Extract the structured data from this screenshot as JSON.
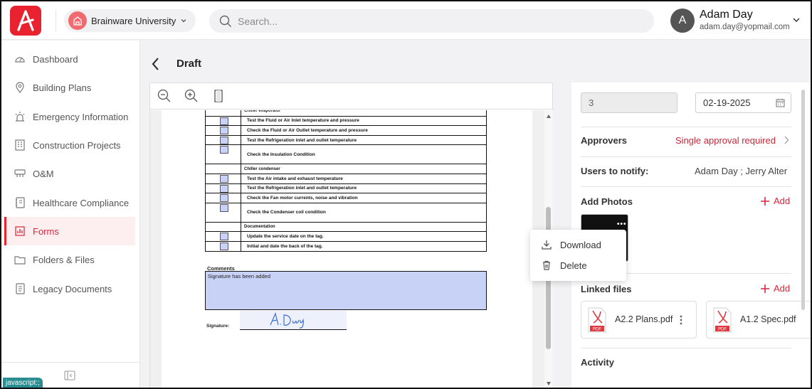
{
  "org": {
    "name": "Brainware University"
  },
  "search": {
    "placeholder": "Search..."
  },
  "user": {
    "initial": "A",
    "name": "Adam Day",
    "email": "adam.day@yopmail.com"
  },
  "sidebar": {
    "items": [
      {
        "label": "Dashboard",
        "icon": "dashboard-icon"
      },
      {
        "label": "Building Plans",
        "icon": "location-pin-icon"
      },
      {
        "label": "Emergency Information",
        "icon": "alarm-light-icon"
      },
      {
        "label": "Construction Projects",
        "icon": "building-icon"
      },
      {
        "label": "O&M",
        "icon": "hvac-icon"
      },
      {
        "label": "Healthcare Compliance",
        "icon": "notebook-icon"
      },
      {
        "label": "Forms",
        "icon": "bar-chart-icon",
        "active": true
      },
      {
        "label": "Folders & Files",
        "icon": "folder-icon"
      },
      {
        "label": "Legacy Documents",
        "icon": "document-icon"
      }
    ],
    "status_tip": "javascript:;"
  },
  "page": {
    "title": "Draft"
  },
  "document": {
    "rows": [
      {
        "type": "section",
        "text": "Chiller evaporator"
      },
      {
        "type": "item",
        "text": "Test the Fluid or Air Inlet temperature and pressure"
      },
      {
        "type": "item",
        "text": "Check the Fluid or Air Outlet temperature and pressure"
      },
      {
        "type": "item",
        "text": "Test the Refrigeration inlet and outlet temperature"
      },
      {
        "type": "item-tall",
        "text": "Check the Insulation Condition"
      },
      {
        "type": "section",
        "text": "Chiller condenser"
      },
      {
        "type": "item",
        "text": "Test the Air intake and exhaust temperature"
      },
      {
        "type": "item",
        "text": "Test the Refrigeration inlet and outlet temperature"
      },
      {
        "type": "item",
        "text": "Check the Fan motor currents, noise and vibration"
      },
      {
        "type": "item-tall",
        "text": "Check the Condenser coil condition"
      },
      {
        "type": "section",
        "text": "Documentation"
      },
      {
        "type": "item",
        "text": "Update the service date on the tag."
      },
      {
        "type": "item",
        "text": "Initial and date the back of the tag."
      }
    ],
    "comments_label": "Comments",
    "comments_text": "Signature has been added",
    "signature_label": "Signature:",
    "signature_text": "A.Day"
  },
  "context_menu": {
    "download": "Download",
    "delete": "Delete"
  },
  "panel": {
    "field_value": "3",
    "date_value": "02-19-2025",
    "approvers_label": "Approvers",
    "approvers_value": "Single approval required",
    "notify_label": "Users to notify:",
    "notify_value": "Adam Day ;   Jerry Alter",
    "photos_label": "Add Photos",
    "add_label": "Add",
    "linked_label": "Linked files",
    "files": [
      {
        "name": "A2.2 Plans.pdf",
        "badge": "PDF"
      },
      {
        "name": "A1.2 Spec.pdf",
        "badge": "PDF"
      }
    ],
    "activity_label": "Activity"
  },
  "colors": {
    "brand": "#e8232f",
    "accent_text": "#c8283a",
    "field_highlight": "#c8d2f6"
  }
}
